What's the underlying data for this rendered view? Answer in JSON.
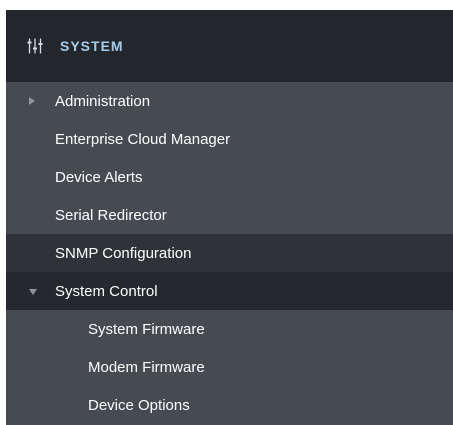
{
  "header": {
    "icon": "sliders-icon",
    "title": "SYSTEM"
  },
  "colors": {
    "header_bg": "#23272b",
    "panel_bg": "#464b51",
    "selected_bg": "#2f3337",
    "open_bg": "#25292d",
    "title_color": "#a6ccec"
  },
  "menu": {
    "items": [
      {
        "label": "Administration",
        "icon": "chevron-right-icon"
      },
      {
        "label": "Enterprise Cloud Manager"
      },
      {
        "label": "Device Alerts"
      },
      {
        "label": "Serial Redirector"
      },
      {
        "label": "SNMP Configuration",
        "state": "selected"
      },
      {
        "label": "System Control",
        "icon": "chevron-down-icon",
        "state": "expanded"
      }
    ],
    "subitems": [
      {
        "label": "System Firmware"
      },
      {
        "label": "Modem Firmware"
      },
      {
        "label": "Device Options"
      }
    ]
  }
}
